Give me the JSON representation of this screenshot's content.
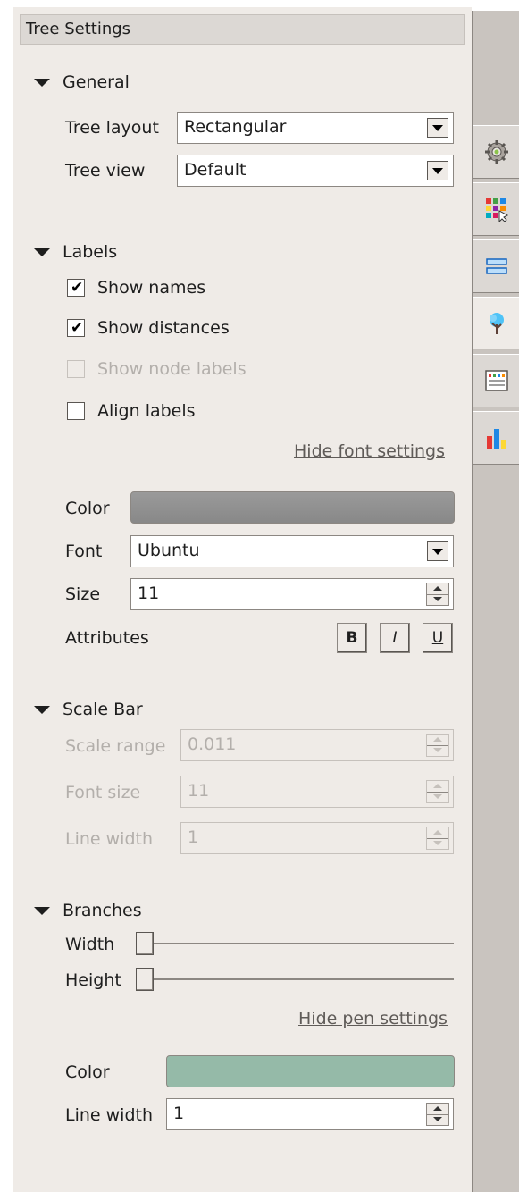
{
  "header": {
    "title": "Tree Settings"
  },
  "general": {
    "title": "General",
    "tree_layout_label": "Tree layout",
    "tree_layout_value": "Rectangular",
    "tree_view_label": "Tree view",
    "tree_view_value": "Default"
  },
  "labels": {
    "title": "Labels",
    "show_names": {
      "label": "Show names",
      "checked": true
    },
    "show_distances": {
      "label": "Show distances",
      "checked": true
    },
    "show_node_labels": {
      "label": "Show node labels",
      "checked": false,
      "disabled": true
    },
    "align_labels": {
      "label": "Align labels",
      "checked": false
    },
    "hide_font_link": "Hide font settings",
    "color_label": "Color",
    "color_value": "#888888",
    "font_label": "Font",
    "font_value": "Ubuntu",
    "size_label": "Size",
    "size_value": "11",
    "attributes_label": "Attributes",
    "bold": "B",
    "italic": "I",
    "underline": "U"
  },
  "scale_bar": {
    "title": "Scale Bar",
    "scale_range_label": "Scale range",
    "scale_range_value": "0.011",
    "font_size_label": "Font size",
    "font_size_value": "11",
    "line_width_label": "Line width",
    "line_width_value": "1"
  },
  "branches": {
    "title": "Branches",
    "width_label": "Width",
    "width_level": 0,
    "height_label": "Height",
    "height_level": 0,
    "hide_pen_link": "Hide pen settings",
    "color_label": "Color",
    "color_value": "#95baa8",
    "line_width_label": "Line width",
    "line_width_value": "1"
  },
  "side_tabs": [
    "settings-gear-icon",
    "colored-grid-icon",
    "layout-bars-icon",
    "tree-icon",
    "data-table-icon",
    "bar-chart-icon"
  ],
  "side_tabs_active": 3
}
